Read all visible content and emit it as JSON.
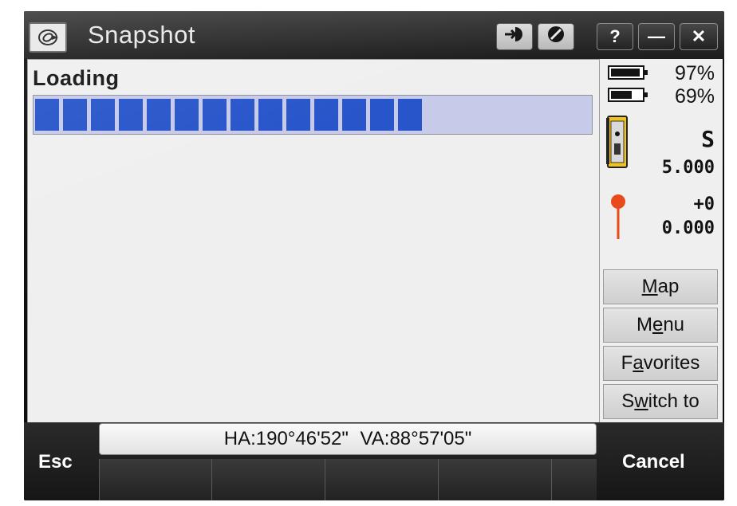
{
  "title_bar": {
    "title": "Snapshot",
    "buttons": {
      "help": "?",
      "minimize": "—",
      "close": "✕"
    },
    "icons": [
      "app-logo-icon",
      "connect-arrow-icon",
      "no-entry-icon"
    ]
  },
  "main": {
    "status_label": "Loading",
    "progress": {
      "filled_segments": 14,
      "total_segments": 20
    }
  },
  "side": {
    "battery1_pct": "97%",
    "battery2_pct": "69%",
    "instrument_mode": "S",
    "instrument_value": "5.000",
    "prism_offset": "+0",
    "prism_height": "0.000",
    "buttons": [
      {
        "pre": "",
        "key": "M",
        "post": "ap"
      },
      {
        "pre": "M",
        "key": "e",
        "post": "nu"
      },
      {
        "pre": "F",
        "key": "a",
        "post": "vorites"
      },
      {
        "pre": "S",
        "key": "w",
        "post": "itch to"
      }
    ]
  },
  "bottom": {
    "angles": "HA:190°46'52\"  VA:88°57'05\"",
    "esc_label": "Esc",
    "cancel_label": "Cancel"
  },
  "colors": {
    "progress_fill": "#2452c9",
    "progress_track": "#c7c9ea",
    "prism_red": "#e84a1a"
  }
}
